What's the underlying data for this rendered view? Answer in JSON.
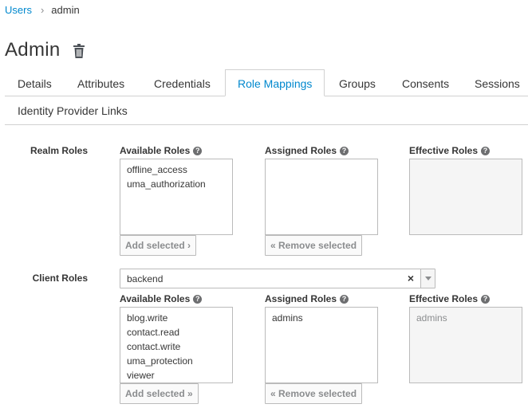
{
  "breadcrumb": {
    "parent": "Users",
    "separator": "›",
    "current": "admin"
  },
  "page": {
    "title": "Admin"
  },
  "tabs": [
    {
      "label": "Details"
    },
    {
      "label": "Attributes"
    },
    {
      "label": "Credentials"
    },
    {
      "label": "Role Mappings",
      "active": true
    },
    {
      "label": "Groups"
    },
    {
      "label": "Consents"
    },
    {
      "label": "Sessions"
    },
    {
      "label": "Identity Provider Links"
    }
  ],
  "realm_roles": {
    "label": "Realm Roles",
    "available_label": "Available Roles",
    "assigned_label": "Assigned Roles",
    "effective_label": "Effective Roles",
    "available": [
      "offline_access",
      "uma_authorization"
    ],
    "assigned": [],
    "effective": [],
    "add_button": "Add selected ›",
    "remove_button": "« Remove selected"
  },
  "client_roles": {
    "label": "Client Roles",
    "client_select": {
      "value": "backend",
      "clear_glyph": "×"
    },
    "available_label": "Available Roles",
    "assigned_label": "Assigned Roles",
    "effective_label": "Effective Roles",
    "available": [
      "blog.write",
      "contact.read",
      "contact.write",
      "uma_protection",
      "viewer"
    ],
    "assigned": [
      "admins"
    ],
    "effective": [
      "admins"
    ],
    "add_button": "Add selected »",
    "remove_button": "« Remove selected"
  },
  "help_glyph": "?"
}
